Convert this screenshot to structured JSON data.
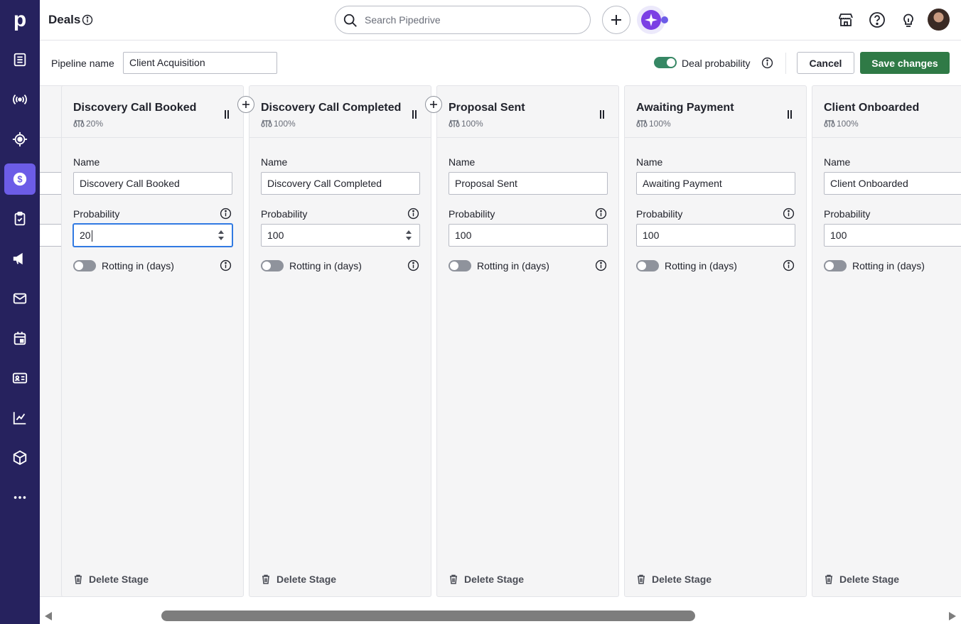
{
  "app": {
    "logo": "p",
    "page_title": "Deals"
  },
  "search": {
    "placeholder": "Search Pipedrive"
  },
  "nav": {
    "items": [
      {
        "icon": "leads-inbox-icon"
      },
      {
        "icon": "broadcast-icon"
      },
      {
        "icon": "target-icon"
      },
      {
        "icon": "deals-dollar-icon",
        "active": true
      },
      {
        "icon": "activities-clipboard-icon"
      },
      {
        "icon": "campaigns-megaphone-icon"
      },
      {
        "icon": "mail-icon"
      },
      {
        "icon": "calendar-icon"
      },
      {
        "icon": "contacts-card-icon"
      },
      {
        "icon": "insights-chart-icon"
      },
      {
        "icon": "products-box-icon"
      },
      {
        "icon": "more-icon"
      }
    ]
  },
  "toolbar": {
    "pipeline_label": "Pipeline name",
    "pipeline_value": "Client Acquisition",
    "deal_probability_label": "Deal probability",
    "deal_probability_on": true,
    "cancel_label": "Cancel",
    "save_label": "Save changes"
  },
  "labels": {
    "name": "Name",
    "probability": "Probability",
    "rotting": "Rotting in (days)",
    "delete": "Delete Stage"
  },
  "stages": [
    {
      "title": "Discovery Call Booked",
      "percent": "20%",
      "name": "Discovery Call Booked",
      "probability": "20"
    },
    {
      "title": "Discovery Call Completed",
      "percent": "100%",
      "name": "Discovery Call Completed",
      "probability": "100"
    },
    {
      "title": "Proposal Sent",
      "percent": "100%",
      "name": "Proposal Sent",
      "probability": "100"
    },
    {
      "title": "Awaiting Payment",
      "percent": "100%",
      "name": "Awaiting Payment",
      "probability": "100"
    },
    {
      "title": "Client Onboarded",
      "percent": "100%",
      "name": "Client Onboarded",
      "probability": "100"
    }
  ],
  "colors": {
    "nav_bg": "#26225e",
    "nav_active": "#6c5ce7",
    "save": "#2f7a46",
    "toggle_on": "#368764",
    "focus": "#317ae2"
  }
}
